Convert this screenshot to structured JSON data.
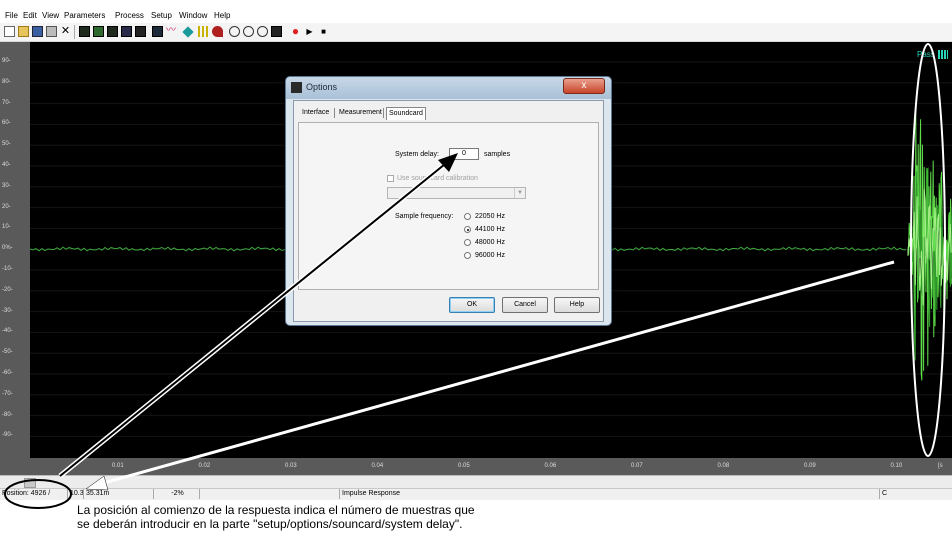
{
  "menubar": [
    "File",
    "Edit",
    "View",
    "Parameters",
    "Process",
    "Setup",
    "Window",
    "Help"
  ],
  "toolbar": {
    "icons": [
      "new-icon",
      "open-icon",
      "save-icon",
      "print-icon",
      "delete-icon",
      "view-1-icon",
      "view-2-icon",
      "view-3-icon",
      "view-4-icon",
      "view-5-icon",
      "view-6-icon",
      "wave-icon",
      "marker-icon",
      "filter-icon",
      "pin-icon",
      "zoom-in-icon",
      "zoom-out-icon",
      "zoom-fit-icon",
      "zoom-all-icon",
      "record-icon",
      "play-icon",
      "stop-icon"
    ]
  },
  "plot": {
    "y_ticks": [
      "90-",
      "80-",
      "70-",
      "60-",
      "50-",
      "40-",
      "30-",
      "20-",
      "10-",
      "0%-",
      "-10-",
      "-20-",
      "-30-",
      "-40-",
      "-50-",
      "-60-",
      "-70-",
      "-80-",
      "-90-"
    ],
    "x_ticks": [
      "0.01",
      "0.02",
      "0.03",
      "0.04",
      "0.05",
      "0.06",
      "0.07",
      "0.08",
      "0.09",
      "0.10"
    ],
    "x_tick_last": "[s",
    "top_right_label": "Pass",
    "signal_color": "#44c844",
    "background": "#000000"
  },
  "statusbar": {
    "position": "Position: 4926 /",
    "pos2": "10.3",
    "pos3": "35.31m",
    "percent": "-2%",
    "type": "Impulse Response",
    "channel": "C"
  },
  "dialog": {
    "title": "Options",
    "close": "x",
    "tabs": [
      "Interface",
      "Measurement",
      "Soundcard"
    ],
    "active_tab": "Soundcard",
    "system_delay_label": "System delay:",
    "system_delay_value": "0",
    "samples_label": "samples",
    "calibration_label": "Use soundcard calibration",
    "sample_freq_label": "Sample frequency:",
    "freqs": [
      {
        "label": "22050 Hz",
        "selected": false
      },
      {
        "label": "44100 Hz",
        "selected": true
      },
      {
        "label": "48000 Hz",
        "selected": false
      },
      {
        "label": "96000 Hz",
        "selected": false
      }
    ],
    "buttons": {
      "ok": "OK",
      "cancel": "Cancel",
      "help": "Help"
    }
  },
  "caption": {
    "line1": "La posición al comienzo de la respuesta indica el número de muestras que",
    "line2": "se deberán introducir en la parte \"setup/options/souncard/system delay\"."
  },
  "annotation_colors": {
    "black_arrow": "#000000",
    "white_arrow": "#ffffff"
  }
}
